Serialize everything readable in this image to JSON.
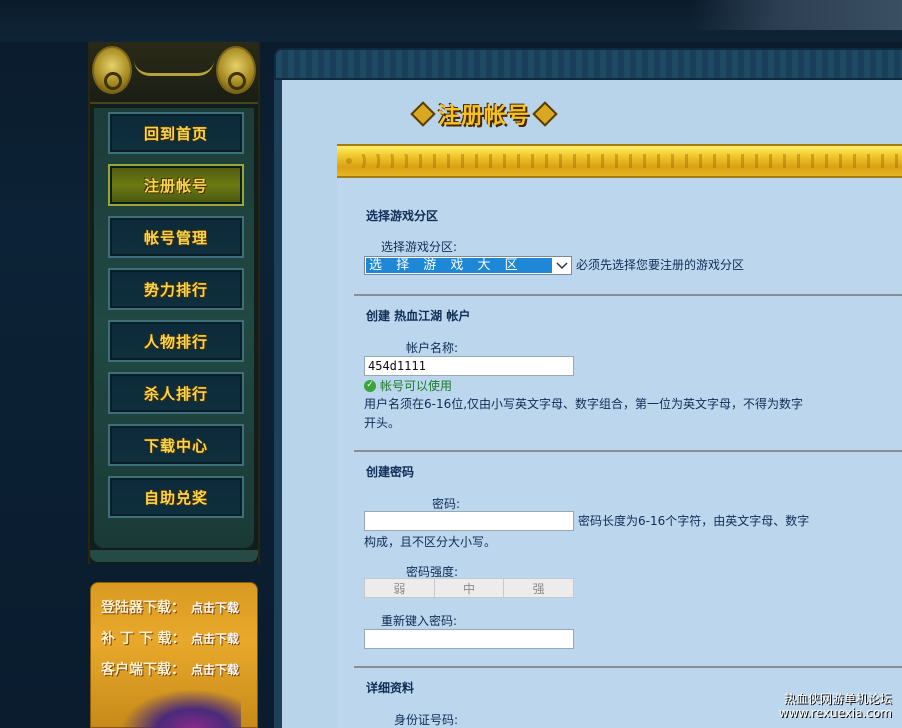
{
  "nav": {
    "items": [
      {
        "label": "回到首页",
        "active": false
      },
      {
        "label": "注册帐号",
        "active": true
      },
      {
        "label": "帐号管理",
        "active": false
      },
      {
        "label": "势力排行",
        "active": false
      },
      {
        "label": "人物排行",
        "active": false
      },
      {
        "label": "杀人排行",
        "active": false
      },
      {
        "label": "下载中心",
        "active": false
      },
      {
        "label": "自助兑奖",
        "active": false
      }
    ]
  },
  "downloads": {
    "rows": [
      {
        "label": "登陆器下载：",
        "link": "点击下载"
      },
      {
        "label": "补 丁 下 载：",
        "link": "点击下载"
      },
      {
        "label": "客户端下载：",
        "link": "点击下载"
      }
    ]
  },
  "page": {
    "title": "注册帐号"
  },
  "form": {
    "zone": {
      "section_title": "选择游戏分区",
      "label": "选择游戏分区:",
      "selected": "选 择 游 戏 大 区",
      "hint": "必须先选择您要注册的游戏分区"
    },
    "account": {
      "section_title": "创建 热血江湖 帐户",
      "label": "帐户名称:",
      "value": "454d1111",
      "status": "帐号可以使用",
      "hint_line1": "用户名须在6-16位,仅由小写英文字母、数字组合，第一位为英文字母，不得为数字",
      "hint_line2": "开头。"
    },
    "password": {
      "section_title": "创建密码",
      "label": "密码:",
      "value": "",
      "hint_line1": "密码长度为6-16个字符，由英文字母、数字",
      "hint_line2": "构成，且不区分大小写。",
      "strength_label": "密码强度:",
      "strength_levels": [
        "弱",
        "中",
        "强"
      ],
      "confirm_label": "重新键入密码:",
      "confirm_value": ""
    },
    "details": {
      "section_title": "详细资料",
      "id_label": "身份证号码:"
    }
  },
  "watermark": {
    "line1": "热血侠网游单机论坛",
    "line2": "www.rexuexia.com"
  },
  "colors": {
    "gold_text": "#f6d850",
    "panel_bg": "#b8d4ea",
    "select_highlight": "#1e88d6",
    "ok_green": "#1c7a2a"
  }
}
